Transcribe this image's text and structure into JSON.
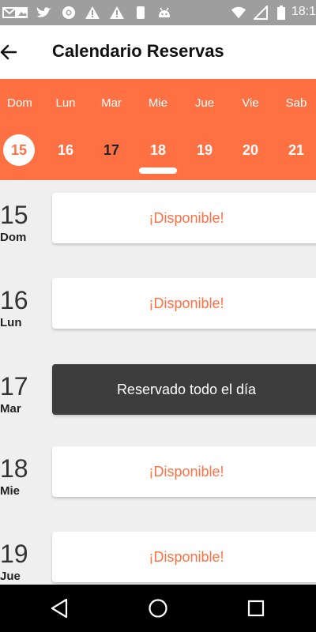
{
  "status_bar": {
    "time": "18:1",
    "icons": [
      "mail-icon",
      "image-icon",
      "twitter-icon",
      "chrome-icon",
      "warning-icon",
      "warning-icon",
      "sd-card-icon",
      "android-icon",
      "wifi-icon",
      "no-sim-icon",
      "battery-icon"
    ]
  },
  "header": {
    "title": "Calendario Reservas",
    "back_icon": "arrow-left-icon"
  },
  "week": {
    "days": [
      {
        "label": "Dom",
        "num": "15",
        "state": "selected"
      },
      {
        "label": "Lun",
        "num": "16",
        "state": "normal"
      },
      {
        "label": "Mar",
        "num": "17",
        "state": "reserved"
      },
      {
        "label": "Mie",
        "num": "18",
        "state": "normal"
      },
      {
        "label": "Jue",
        "num": "19",
        "state": "normal"
      },
      {
        "label": "Vie",
        "num": "20",
        "state": "normal"
      },
      {
        "label": "Sab",
        "num": "21",
        "state": "normal"
      }
    ]
  },
  "schedule": [
    {
      "num": "15",
      "weekday": "Dom",
      "status": "¡Disponible!",
      "reserved": false
    },
    {
      "num": "16",
      "weekday": "Lun",
      "status": "¡Disponible!",
      "reserved": false
    },
    {
      "num": "17",
      "weekday": "Mar",
      "status": "Reservado todo el día",
      "reserved": true
    },
    {
      "num": "18",
      "weekday": "Mie",
      "status": "¡Disponible!",
      "reserved": false
    },
    {
      "num": "19",
      "weekday": "Jue",
      "status": "¡Disponible!",
      "reserved": false
    }
  ],
  "colors": {
    "accent": "#ff7043",
    "reserved_bg": "#3d3d3d",
    "status_bar": "#9e9e9e"
  },
  "nav_bar": {
    "icons": [
      "back-triangle-icon",
      "home-circle-icon",
      "recents-square-icon"
    ]
  }
}
